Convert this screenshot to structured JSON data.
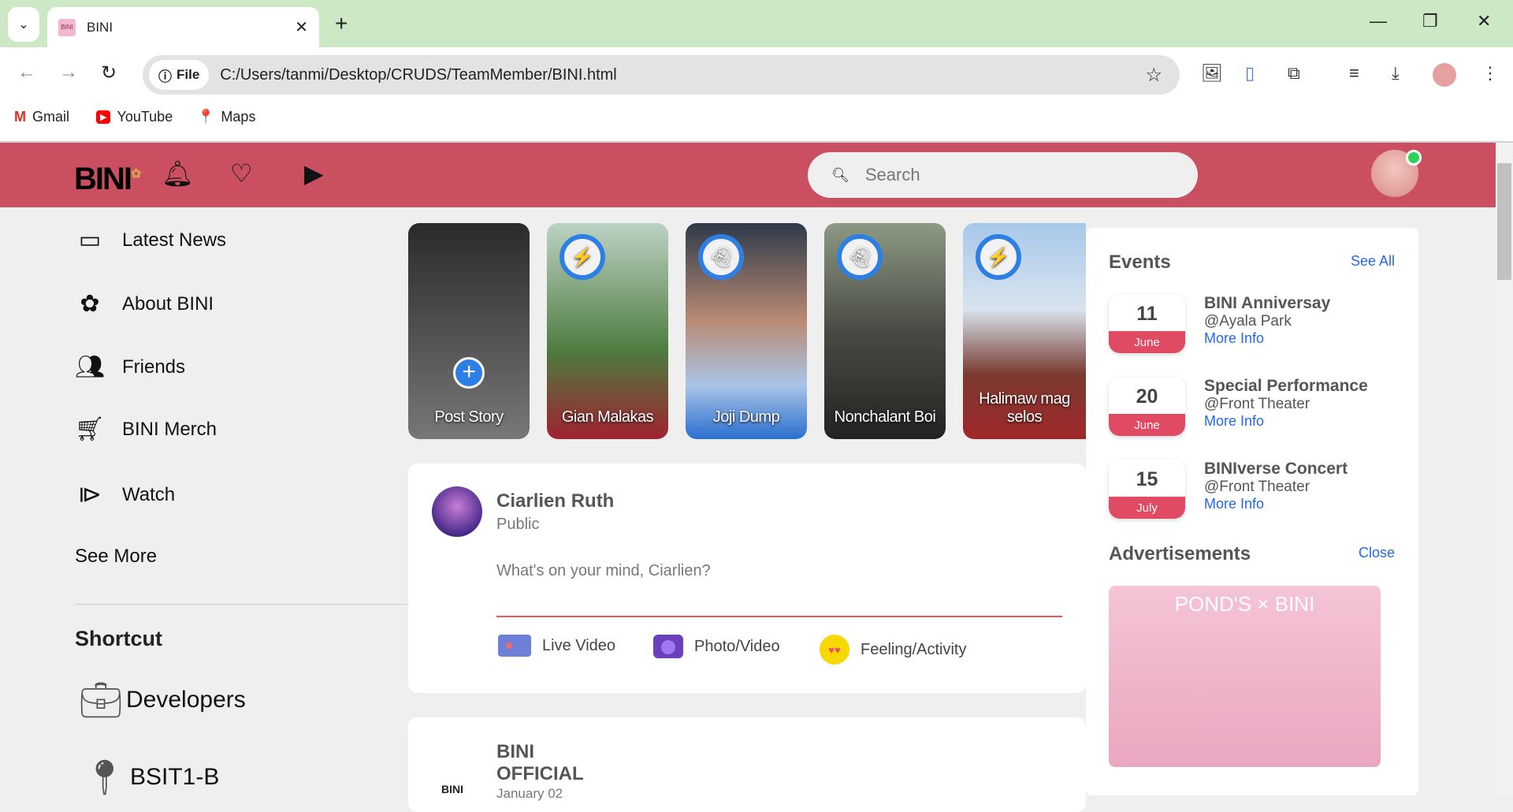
{
  "browser": {
    "tab_title": "BINI",
    "url_chip": "File",
    "url": "C:/Users/tanmi/Desktop/CRUDS/TeamMember/BINI.html",
    "bookmarks": [
      "Gmail",
      "YouTube",
      "Maps"
    ]
  },
  "header": {
    "logo": "BINI",
    "search_placeholder": "Search"
  },
  "sidebar": {
    "items": [
      {
        "label": "Latest News",
        "icon": "newspaper-icon"
      },
      {
        "label": "About BINI",
        "icon": "flower-icon"
      },
      {
        "label": "Friends",
        "icon": "users-icon"
      },
      {
        "label": "BINI Merch",
        "icon": "cart-icon"
      },
      {
        "label": "Watch",
        "icon": "tv-icon"
      }
    ],
    "see_more": "See More",
    "shortcut_title": "Shortcut",
    "shortcuts": [
      {
        "label": "Developers",
        "icon": "briefcase-icon"
      },
      {
        "label": "BSIT1-B",
        "icon": "map-pin-icon"
      }
    ]
  },
  "stories": [
    {
      "label": "Post Story"
    },
    {
      "label": "Gian Malakas"
    },
    {
      "label": "Joji Dump"
    },
    {
      "label": "Nonchalant Boi"
    },
    {
      "label": "Halimaw mag selos"
    }
  ],
  "composer": {
    "name": "Ciarlien Ruth",
    "privacy": "Public",
    "placeholder": "What's on your mind, Ciarlien?",
    "actions": [
      "Live Video",
      "Photo/Video",
      "Feeling/Activity"
    ]
  },
  "post": {
    "author_line1": "BINI",
    "author_line2": "OFFICIAL",
    "date": "January 02"
  },
  "events": {
    "title": "Events",
    "see_all": "See All",
    "items": [
      {
        "day": "11",
        "month": "June",
        "name": "BINI Anniversay",
        "place": "@Ayala Park",
        "link": "More Info"
      },
      {
        "day": "20",
        "month": "June",
        "name": "Special Performance",
        "place": "@Front Theater",
        "link": "More Info"
      },
      {
        "day": "15",
        "month": "July",
        "name": "BINIverse Concert",
        "place": "@Front Theater",
        "link": "More Info"
      }
    ]
  },
  "ads": {
    "title": "Advertisements",
    "close": "Close",
    "image_text": "POND'S × BINI"
  }
}
